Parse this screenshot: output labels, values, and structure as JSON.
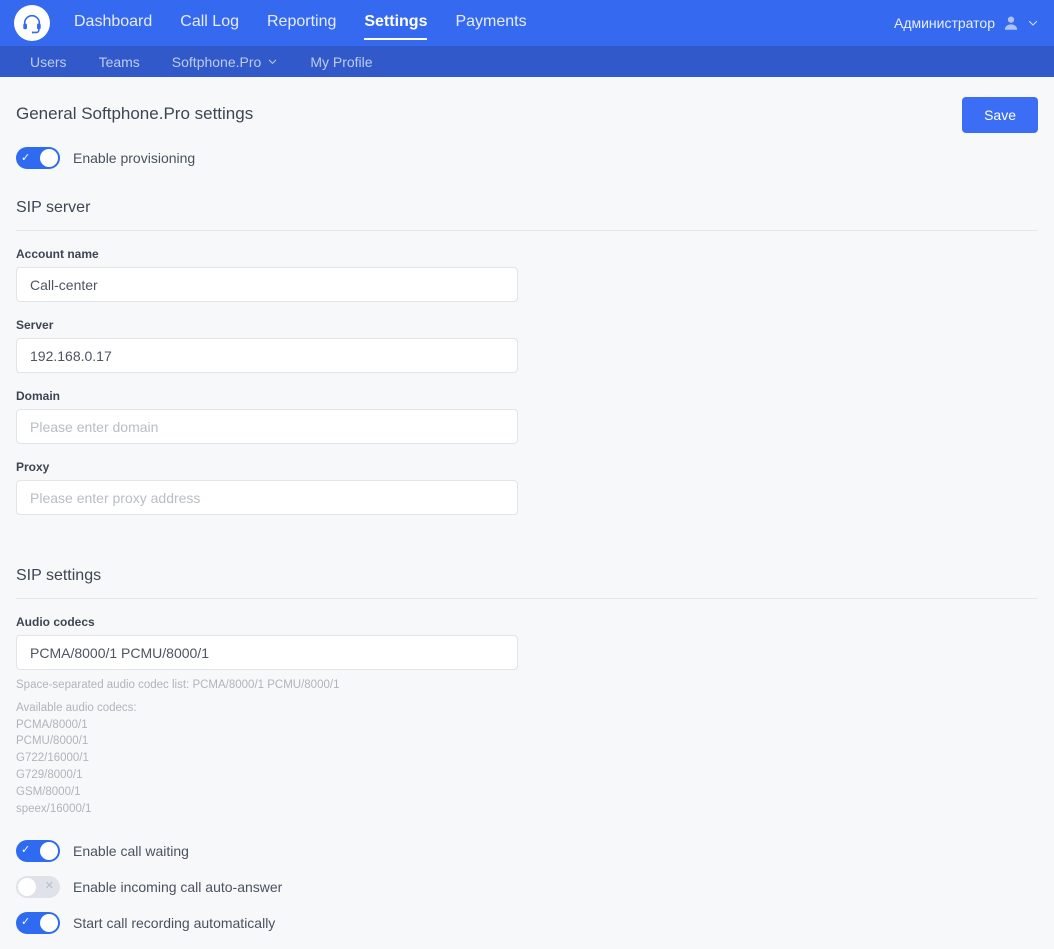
{
  "header": {
    "logo_icon": "headset-icon",
    "nav": [
      {
        "label": "Dashboard",
        "active": false
      },
      {
        "label": "Call Log",
        "active": false
      },
      {
        "label": "Reporting",
        "active": false
      },
      {
        "label": "Settings",
        "active": true
      },
      {
        "label": "Payments",
        "active": false
      }
    ],
    "user": {
      "name": "Администратор",
      "avatar_icon": "person-icon",
      "chevron_icon": "chevron-down-icon"
    },
    "colors": {
      "topbar": "#3469f0",
      "subnav": "#3159c9",
      "accent": "#3b6ef5"
    }
  },
  "subnav": {
    "items": [
      {
        "label": "Users",
        "has_chevron": false
      },
      {
        "label": "Teams",
        "has_chevron": false
      },
      {
        "label": "Softphone.Pro",
        "has_chevron": true
      },
      {
        "label": "My Profile",
        "has_chevron": false
      }
    ]
  },
  "page": {
    "title": "General Softphone.Pro settings",
    "save_label": "Save",
    "provisioning": {
      "label": "Enable provisioning",
      "state": "on"
    }
  },
  "sip_server": {
    "title": "SIP server",
    "fields": [
      {
        "label": "Account name",
        "value": "Call-center",
        "placeholder": ""
      },
      {
        "label": "Server",
        "value": "192.168.0.17",
        "placeholder": ""
      },
      {
        "label": "Domain",
        "value": "",
        "placeholder": "Please enter domain"
      },
      {
        "label": "Proxy",
        "value": "",
        "placeholder": "Please enter proxy address"
      }
    ]
  },
  "sip_settings": {
    "title": "SIP settings",
    "audio_codecs": {
      "label": "Audio codecs",
      "value": "PCMA/8000/1 PCMU/8000/1",
      "hint": "Space-separated audio codec list: PCMA/8000/1 PCMU/8000/1",
      "available_title": "Available audio codecs:",
      "available": [
        "PCMA/8000/1",
        "PCMU/8000/1",
        "G722/16000/1",
        "G729/8000/1",
        "GSM/8000/1",
        "speex/16000/1"
      ]
    },
    "toggles": [
      {
        "label": "Enable call waiting",
        "state": "on"
      },
      {
        "label": "Enable incoming call auto-answer",
        "state": "off"
      },
      {
        "label": "Start call recording automatically",
        "state": "on"
      }
    ]
  }
}
